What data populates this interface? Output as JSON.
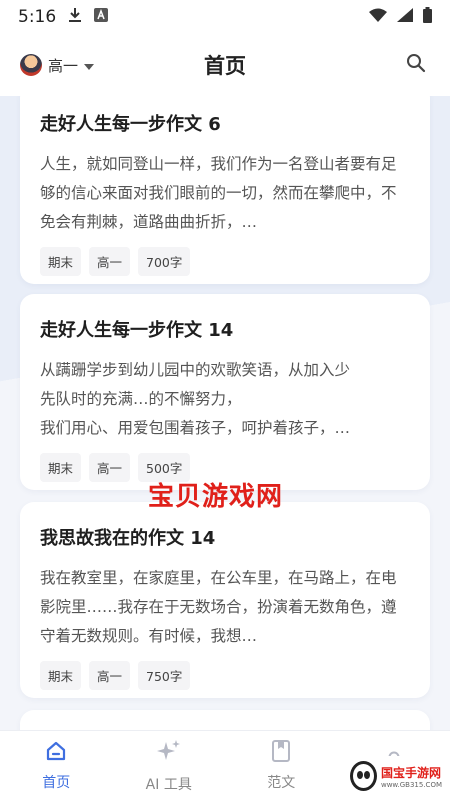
{
  "status_bar": {
    "time": "5:16",
    "icons": [
      "download-icon",
      "app-a-icon",
      "wifi-icon",
      "signal-icon",
      "battery-icon"
    ]
  },
  "header": {
    "grade": "高一",
    "title": "首页",
    "search_icon": "search-icon"
  },
  "cards": [
    {
      "title": "走好人生每一步作文 6",
      "excerpt": "人生，就如同登山一样，我们作为一名登山者要有足够的信心来面对我们眼前的一切，然而在攀爬中，不免会有荆棘，道路曲曲折折，…",
      "tags": [
        "期末",
        "高一",
        "700字"
      ]
    },
    {
      "title": "走好人生每一步作文 14",
      "excerpt": "从蹒跚学步到幼儿园中的欢歌笑语，从加入少先队时的充满…我们用心、用爱包围着孩子，呵护着孩子，…",
      "excerpt_lines": [
        "从蹒跚学步到幼儿园中的欢歌笑语，从加入少",
        "先队时的充满…的不懈努力，",
        "我们用心、用爱包围着孩子，呵护着孩子，…"
      ],
      "tags": [
        "期末",
        "高一",
        "500字"
      ]
    },
    {
      "title": "我思故我在的作文 14",
      "excerpt": "我在教室里，在家庭里，在公车里，在马路上，在电影院里……我存在于无数场合，扮演着无数角色，遵守着无数规则。有时候，我想…",
      "tags": [
        "期末",
        "高一",
        "750字"
      ]
    }
  ],
  "watermark": "宝贝游戏网",
  "tab_bar": [
    {
      "label": "首页",
      "icon": "home-icon",
      "active": true
    },
    {
      "label": "AI 工具",
      "icon": "sparkle-icon",
      "active": false
    },
    {
      "label": "范文",
      "icon": "bookmark-icon",
      "active": false
    },
    {
      "label": "",
      "icon": "user-icon",
      "active": false
    }
  ],
  "corner_logo": {
    "main": "国宝手游网",
    "sub": "www.GB315.COM"
  },
  "colors": {
    "accent": "#3f6fe0",
    "watermark": "#e0201a"
  }
}
